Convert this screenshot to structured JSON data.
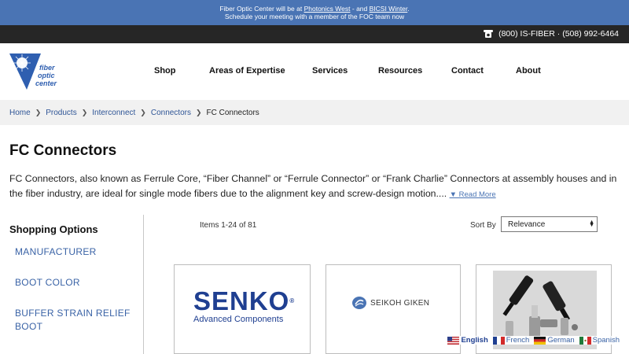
{
  "announcement": {
    "line1_prefix": "Fiber Optic Center will be at",
    "link1": "Photonics West",
    "line1_mid": "- and",
    "link2": "BICSI Winter",
    "line1_end": ".",
    "line2": "Schedule your meeting with a member of the FOC team now"
  },
  "contact": {
    "phone": "(800) IS-FIBER · (508) 992-6464",
    "icon": "telephone-icon"
  },
  "logo": {
    "line1": "fiber",
    "line2": "optic",
    "line3": "center"
  },
  "nav": [
    "Shop",
    "Areas of Expertise",
    "Services",
    "Resources",
    "Contact",
    "About"
  ],
  "breadcrumb": {
    "items": [
      "Home",
      "Products",
      "Interconnect",
      "Connectors"
    ],
    "current": "FC Connectors"
  },
  "page": {
    "title": "FC Connectors",
    "description": "FC Connectors, also known as Ferrule Core, “Fiber Channel” or “Ferrule Connector” or “Frank Charlie” Connectors at assembly houses and in the fiber industry, are ideal for single mode fibers due to the alignment key and screw-design motion....",
    "read_more": "▼ Read More"
  },
  "sidebar": {
    "heading": "Shopping Options",
    "options": [
      "MANUFACTURER",
      "BOOT COLOR",
      "BUFFER STRAIN RELIEF BOOT"
    ]
  },
  "toolbar": {
    "count": "Items 1-24 of 81",
    "sort_label": "Sort By",
    "sort_value": "Relevance"
  },
  "products": [
    {
      "brand": "SENKO",
      "reg": "®",
      "subtitle": "Advanced Components"
    },
    {
      "brand": "SEIKOH GIKEN"
    },
    {
      "image": "fc-connector-photo"
    }
  ],
  "languages": [
    {
      "label": "English",
      "active": true
    },
    {
      "label": "French",
      "active": false
    },
    {
      "label": "German",
      "active": false
    },
    {
      "label": "Spanish",
      "active": false
    }
  ],
  "colors": {
    "announce_bg": "#4a74b4",
    "topbar_bg": "#262626",
    "link": "#2f5596",
    "senko_blue": "#1f3f91"
  }
}
